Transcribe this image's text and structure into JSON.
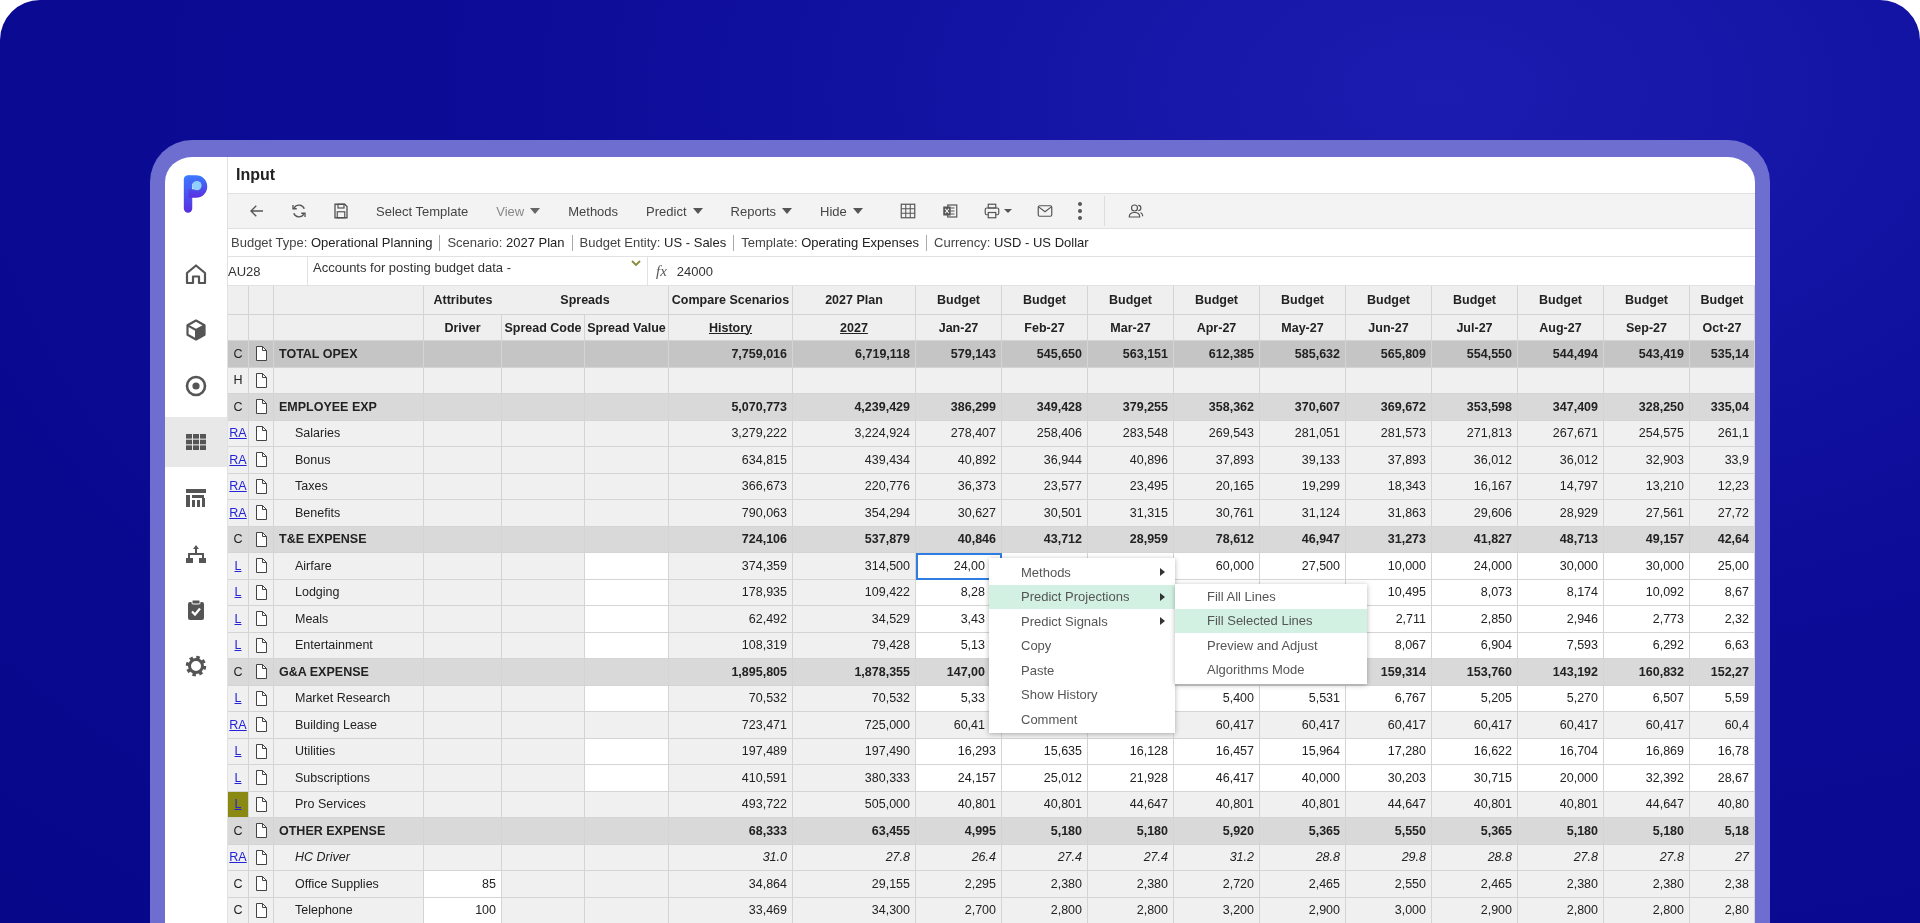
{
  "sidebar": {
    "items": [
      {
        "selected": false
      },
      {
        "selected": false
      },
      {
        "selected": false
      },
      {
        "selected": true
      },
      {
        "selected": false
      },
      {
        "selected": false
      },
      {
        "selected": false
      },
      {
        "selected": false
      }
    ]
  },
  "page_title": "Input",
  "toolbar": {
    "buttons": [
      {
        "label": "Select Template",
        "dropdown": false,
        "disabled": false
      },
      {
        "label": "View",
        "dropdown": true,
        "disabled": true
      },
      {
        "label": "Methods",
        "dropdown": false,
        "disabled": false
      },
      {
        "label": "Predict",
        "dropdown": true,
        "disabled": false
      },
      {
        "label": "Reports",
        "dropdown": true,
        "disabled": false
      },
      {
        "label": "Hide",
        "dropdown": true,
        "disabled": false
      }
    ]
  },
  "info_bar": [
    {
      "label": "Budget Type:",
      "value": "Operational Planning"
    },
    {
      "label": "Scenario:",
      "value": "2027 Plan"
    },
    {
      "label": "Budget Entity:",
      "value": "US - Sales"
    },
    {
      "label": "Template:",
      "value": "Operating Expenses"
    },
    {
      "label": "Currency:",
      "value": "USD - US Dollar"
    }
  ],
  "formula_bar": {
    "cell": "AU28",
    "account": "Accounts for posting budget data -",
    "fx": "fx",
    "value": "24000"
  },
  "table": {
    "group_headers": [
      "Attributes",
      "Spreads",
      "Compare Scenarios",
      "2027 Plan",
      "Budget",
      "Budget",
      "Budget",
      "Budget",
      "Budget",
      "Budget",
      "Budget",
      "Budget",
      "Budget",
      "Budget"
    ],
    "columns": [
      {
        "label": "Driver",
        "underlined": false
      },
      {
        "label": "Spread Code",
        "underlined": false
      },
      {
        "label": "Spread Value",
        "underlined": false
      },
      {
        "label": "History",
        "underlined": true
      },
      {
        "label": "2027",
        "underlined": true
      },
      {
        "label": "Jan-27",
        "underlined": false
      },
      {
        "label": "Feb-27",
        "underlined": false
      },
      {
        "label": "Mar-27",
        "underlined": false
      },
      {
        "label": "Apr-27",
        "underlined": false
      },
      {
        "label": "May-27",
        "underlined": false
      },
      {
        "label": "Jun-27",
        "underlined": false
      },
      {
        "label": "Jul-27",
        "underlined": false
      },
      {
        "label": "Aug-27",
        "underlined": false
      },
      {
        "label": "Sep-27",
        "underlined": false
      },
      {
        "label": "Oct-27",
        "underlined": false
      }
    ],
    "rows": [
      {
        "code": "C",
        "code_link": false,
        "code_highlighted": false,
        "kind": "total",
        "name": "TOTAL OPEX",
        "editable": false,
        "cursor": false,
        "values": [
          "7,759,016",
          "6,719,118",
          "579,143",
          "545,650",
          "563,151",
          "612,385",
          "585,632",
          "565,809",
          "554,550",
          "544,494",
          "543,419",
          "535,14"
        ]
      },
      {
        "code": "H",
        "code_link": false,
        "code_highlighted": false,
        "kind": "header",
        "editable": false,
        "cursor": false
      },
      {
        "code": "C",
        "code_link": false,
        "code_highlighted": false,
        "kind": "group",
        "name": "EMPLOYEE EXP",
        "editable": false,
        "cursor": false,
        "values": [
          "5,070,773",
          "4,239,429",
          "386,299",
          "349,428",
          "379,255",
          "358,362",
          "370,607",
          "369,672",
          "353,598",
          "347,409",
          "328,250",
          "335,04"
        ]
      },
      {
        "code": "RA",
        "code_link": true,
        "code_highlighted": false,
        "kind": "line",
        "name": "Salaries",
        "editable": false,
        "cursor": false,
        "values": [
          "3,279,222",
          "3,224,924",
          "278,407",
          "258,406",
          "283,548",
          "269,543",
          "281,051",
          "281,573",
          "271,813",
          "267,671",
          "254,575",
          "261,1"
        ]
      },
      {
        "code": "RA",
        "code_link": true,
        "code_highlighted": false,
        "kind": "line",
        "name": "Bonus",
        "editable": false,
        "cursor": false,
        "values": [
          "634,815",
          "439,434",
          "40,892",
          "36,944",
          "40,896",
          "37,893",
          "39,133",
          "37,893",
          "36,012",
          "36,012",
          "32,903",
          "33,9"
        ]
      },
      {
        "code": "RA",
        "code_link": true,
        "code_highlighted": false,
        "kind": "line",
        "name": "Taxes",
        "editable": false,
        "cursor": false,
        "values": [
          "366,673",
          "220,776",
          "36,373",
          "23,577",
          "23,495",
          "20,165",
          "19,299",
          "18,343",
          "16,167",
          "14,797",
          "13,210",
          "12,23"
        ]
      },
      {
        "code": "RA",
        "code_link": true,
        "code_highlighted": false,
        "kind": "line",
        "name": "Benefits",
        "editable": false,
        "cursor": false,
        "values": [
          "790,063",
          "354,294",
          "30,627",
          "30,501",
          "31,315",
          "30,761",
          "31,124",
          "31,863",
          "29,606",
          "28,929",
          "27,561",
          "27,72"
        ]
      },
      {
        "code": "C",
        "code_link": false,
        "code_highlighted": false,
        "kind": "group",
        "name": "T&E EXPENSE",
        "editable": false,
        "cursor": false,
        "values": [
          "724,106",
          "537,879",
          "40,846",
          "43,712",
          "28,959",
          "78,612",
          "46,947",
          "31,273",
          "41,827",
          "48,713",
          "49,157",
          "42,64"
        ]
      },
      {
        "code": "L",
        "code_link": true,
        "code_highlighted": false,
        "kind": "line",
        "name": "Airfare",
        "editable": true,
        "cursor": true,
        "values": [
          "374,359",
          "314,500",
          "24,00",
          "60,000",
          "27,500",
          "10,000",
          "24,000",
          "30,000",
          "30,000",
          "25,00"
        ]
      },
      {
        "code": "L",
        "code_link": true,
        "code_highlighted": false,
        "kind": "line",
        "name": "Lodging",
        "editable": true,
        "cursor": false,
        "values": [
          "178,935",
          "109,422",
          "8,28",
          "10,495",
          "8,073",
          "8,174",
          "10,092",
          "8,67"
        ]
      },
      {
        "code": "L",
        "code_link": true,
        "code_highlighted": false,
        "kind": "line",
        "name": "Meals",
        "editable": true,
        "cursor": false,
        "values": [
          "62,492",
          "34,529",
          "3,43",
          "2,711",
          "2,850",
          "2,946",
          "2,773",
          "2,32"
        ]
      },
      {
        "code": "L",
        "code_link": true,
        "code_highlighted": false,
        "kind": "line",
        "name": "Entertainment",
        "editable": true,
        "cursor": false,
        "values": [
          "108,319",
          "79,428",
          "5,13",
          "8,067",
          "6,904",
          "7,593",
          "6,292",
          "6,63"
        ]
      },
      {
        "code": "C",
        "code_link": false,
        "code_highlighted": false,
        "kind": "group",
        "name": "G&A EXPENSE",
        "editable": false,
        "cursor": false,
        "values": [
          "1,895,805",
          "1,878,355",
          "147,00",
          "159,314",
          "153,760",
          "143,192",
          "160,832",
          "152,27"
        ]
      },
      {
        "code": "L",
        "code_link": true,
        "code_highlighted": false,
        "kind": "line",
        "name": "Market Research",
        "editable": true,
        "cursor": false,
        "values": [
          "70,532",
          "70,532",
          "5,33",
          "5,400",
          "5,531",
          "6,767",
          "5,205",
          "5,270",
          "6,507",
          "5,59"
        ]
      },
      {
        "code": "RA",
        "code_link": true,
        "code_highlighted": false,
        "kind": "line",
        "name": "Building Lease",
        "editable": false,
        "cursor": false,
        "values": [
          "723,471",
          "725,000",
          "60,41",
          "60,417",
          "60,417",
          "60,417",
          "60,417",
          "60,417",
          "60,417",
          "60,4"
        ]
      },
      {
        "code": "L",
        "code_link": true,
        "code_highlighted": false,
        "kind": "line",
        "name": "Utilities",
        "editable": true,
        "cursor": false,
        "values": [
          "197,489",
          "197,490",
          "16,293",
          "15,635",
          "16,128",
          "16,457",
          "15,964",
          "17,280",
          "16,622",
          "16,704",
          "16,869",
          "16,78"
        ]
      },
      {
        "code": "L",
        "code_link": true,
        "code_highlighted": false,
        "kind": "line",
        "name": "Subscriptions",
        "editable": true,
        "cursor": false,
        "values": [
          "410,591",
          "380,333",
          "24,157",
          "25,012",
          "21,928",
          "46,417",
          "40,000",
          "30,203",
          "30,715",
          "20,000",
          "32,392",
          "28,67"
        ]
      },
      {
        "code": "L",
        "code_link": true,
        "code_highlighted": true,
        "kind": "line",
        "name": "Pro Services",
        "editable": false,
        "cursor": false,
        "values": [
          "493,722",
          "505,000",
          "40,801",
          "40,801",
          "44,647",
          "40,801",
          "40,801",
          "44,647",
          "40,801",
          "40,801",
          "44,647",
          "40,80"
        ]
      },
      {
        "code": "C",
        "code_link": false,
        "code_highlighted": false,
        "kind": "group",
        "name": "OTHER EXPENSE",
        "editable": false,
        "cursor": false,
        "values": [
          "68,333",
          "63,455",
          "4,995",
          "5,180",
          "5,180",
          "5,920",
          "5,365",
          "5,550",
          "5,365",
          "5,180",
          "5,180",
          "5,18"
        ]
      },
      {
        "code": "RA",
        "code_link": true,
        "code_highlighted": false,
        "kind": "driver",
        "name": "HC Driver",
        "editable": false,
        "cursor": false,
        "values": [
          "31.0",
          "27.8",
          "26.4",
          "27.4",
          "27.4",
          "31.2",
          "28.8",
          "29.8",
          "28.8",
          "27.8",
          "27.8",
          "27"
        ]
      },
      {
        "code": "C",
        "code_link": false,
        "code_highlighted": false,
        "kind": "line",
        "name": "Office Supplies",
        "driver": "85",
        "editable": false,
        "cursor": false,
        "values": [
          "34,864",
          "29,155",
          "2,295",
          "2,380",
          "2,380",
          "2,720",
          "2,465",
          "2,550",
          "2,465",
          "2,380",
          "2,380",
          "2,38"
        ]
      },
      {
        "code": "C",
        "code_link": false,
        "code_highlighted": false,
        "kind": "line",
        "name": "Telephone",
        "driver": "100",
        "editable": false,
        "cursor": false,
        "values": [
          "33,469",
          "34,300",
          "2,700",
          "2,800",
          "2,800",
          "3,200",
          "2,900",
          "3,000",
          "2,900",
          "2,800",
          "2,800",
          "2,80"
        ]
      }
    ]
  },
  "context_menu": {
    "items": [
      {
        "label": "Methods",
        "submenu": true,
        "selected": false
      },
      {
        "label": "Predict Projections",
        "submenu": true,
        "selected": true
      },
      {
        "label": "Predict Signals",
        "submenu": true,
        "selected": false
      },
      {
        "label": "Copy",
        "submenu": false,
        "selected": false
      },
      {
        "label": "Paste",
        "submenu": false,
        "selected": false
      },
      {
        "label": "Show History",
        "submenu": false,
        "selected": false
      },
      {
        "label": "Comment",
        "submenu": false,
        "selected": false
      }
    ],
    "submenu": [
      {
        "label": "Fill All Lines",
        "selected": false
      },
      {
        "label": "Fill Selected Lines",
        "selected": true
      },
      {
        "label": "Preview and Adjust",
        "selected": false
      },
      {
        "label": "Algorithms Mode",
        "selected": false
      }
    ]
  }
}
